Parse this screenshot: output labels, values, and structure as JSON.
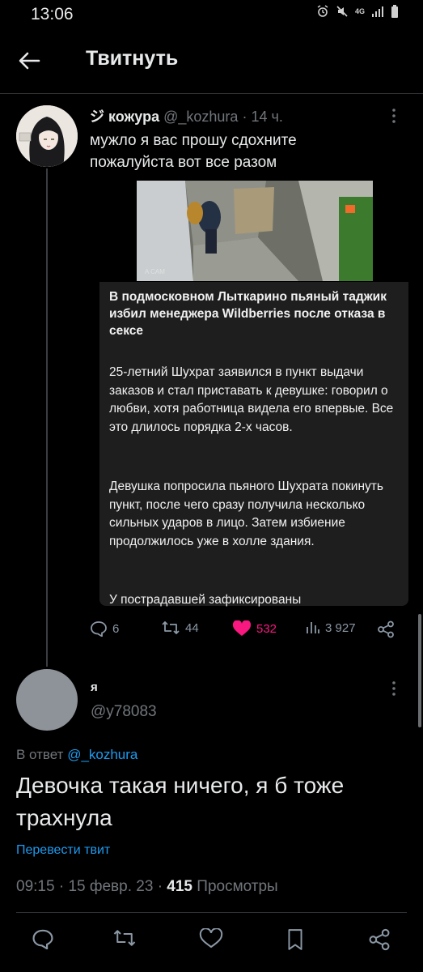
{
  "status_bar": {
    "time": "13:06",
    "network": "4G"
  },
  "header": {
    "title": "Твитнуть"
  },
  "quoted_tweet": {
    "verified_glyph": "ジ",
    "name": "кожура",
    "handle": "@_kozhura",
    "time": "14 ч.",
    "text_line1": "мужло я вас прошу сдохните",
    "text_line2": "пожалуйста вот все разом",
    "media_watermark": "A CAM",
    "news_title": "В подмосковном Лыткарино пьяный таджик избил менеджера Wildberries после отказа в сексе",
    "news_p1": "25-летний Шухрат заявился в пункт выдачи заказов и стал приставать к девушке: говорил о любви, хотя работница видела его впервые. Все это длилось порядка 2-х часов.",
    "news_p2": "Девушка попросила пьяного Шухрата покинуть пункт, после чего сразу получила несколько сильных ударов в лицо. Затем избиение продолжилось уже в холле здания.",
    "news_p3": "У пострадавшей зафиксированы",
    "replies": "6",
    "retweets": "44",
    "likes": "532",
    "views": "3 927"
  },
  "reply": {
    "name": "я",
    "handle": "@y78083",
    "reply_to_prefix": "В ответ",
    "reply_to_mention": "@_kozhura",
    "text": "Девочка такая ничего, я б тоже трахнула",
    "translate": "Перевести твит",
    "time": "09:15",
    "date": "15 февр. 23",
    "views_count": "415",
    "views_label": "Просмотры"
  },
  "colors": {
    "accent": "#1d9bf0",
    "like": "#f91880",
    "secondary": "#71767b"
  }
}
